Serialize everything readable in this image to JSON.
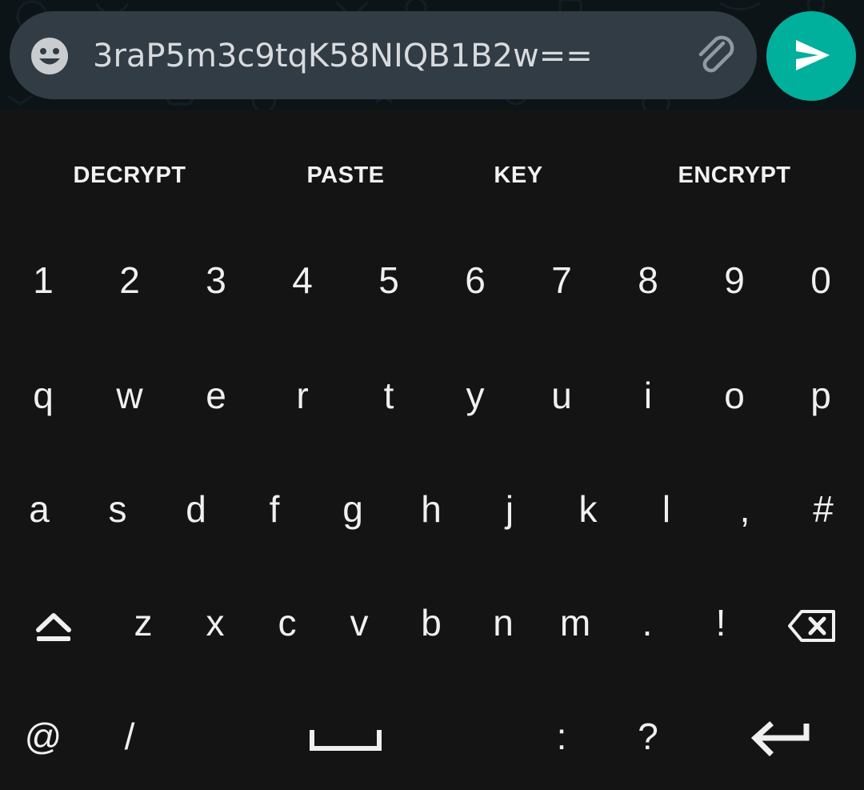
{
  "composer": {
    "message": "3raP5m3c9tqK58NIQB1B2w==",
    "emoji_icon": "emoji-smile-icon",
    "attach_icon": "paperclip-icon",
    "send_icon": "send-arrow-icon",
    "accent": "#00af9c"
  },
  "keyboard": {
    "actions": [
      "DECRYPT",
      "PASTE",
      "KEY",
      "ENCRYPT"
    ],
    "row_numbers": [
      "1",
      "2",
      "3",
      "4",
      "5",
      "6",
      "7",
      "8",
      "9",
      "0"
    ],
    "row_top": [
      "q",
      "w",
      "e",
      "r",
      "t",
      "y",
      "u",
      "i",
      "o",
      "p"
    ],
    "row_home": [
      "a",
      "s",
      "d",
      "f",
      "g",
      "h",
      "j",
      "k",
      "l",
      ",",
      "#"
    ],
    "row_bottom": [
      "z",
      "x",
      "c",
      "v",
      "b",
      "n",
      "m",
      ".",
      "!"
    ],
    "row_last": [
      "@",
      "/",
      ":",
      "?"
    ],
    "icons": {
      "shift": "shift-icon",
      "backspace": "backspace-icon",
      "space": "space-bar-icon",
      "enter": "enter-arrow-icon"
    }
  }
}
